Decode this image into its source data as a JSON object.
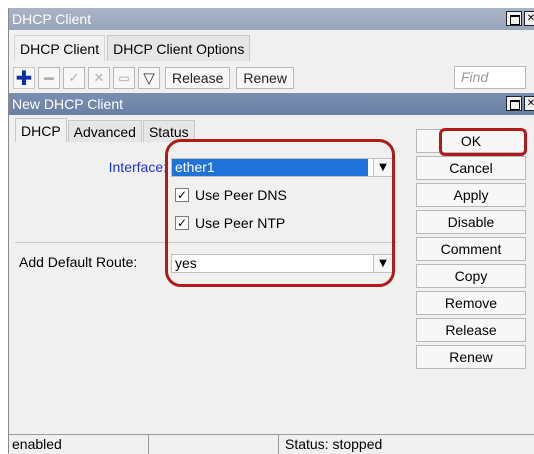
{
  "outer_window": {
    "title": "DHCP Client",
    "tabs": [
      "DHCP Client",
      "DHCP Client Options"
    ],
    "toolbar": {
      "icons": [
        "add-icon",
        "remove-icon",
        "enable-icon",
        "disable-icon",
        "comment-icon",
        "filter-icon"
      ],
      "release_label": "Release",
      "renew_label": "Renew",
      "find_placeholder": "Find"
    }
  },
  "dialog": {
    "title": "New DHCP Client",
    "tabs": [
      "DHCP",
      "Advanced",
      "Status"
    ],
    "interface_label": "Interface:",
    "interface_value": "ether1",
    "use_peer_dns_label": "Use Peer DNS",
    "use_peer_dns_checked": true,
    "use_peer_ntp_label": "Use Peer NTP",
    "use_peer_ntp_checked": true,
    "default_route_label": "Add Default Route:",
    "default_route_value": "yes",
    "buttons": [
      "OK",
      "Cancel",
      "Apply",
      "Disable",
      "Comment",
      "Copy",
      "Remove",
      "Release",
      "Renew"
    ]
  },
  "statusbar": {
    "state": "enabled",
    "middle": "",
    "status": "Status: stopped"
  },
  "colors": {
    "highlight": "#b01a1a",
    "selection": "#1e72d8",
    "interface_label": "#2233cc"
  }
}
